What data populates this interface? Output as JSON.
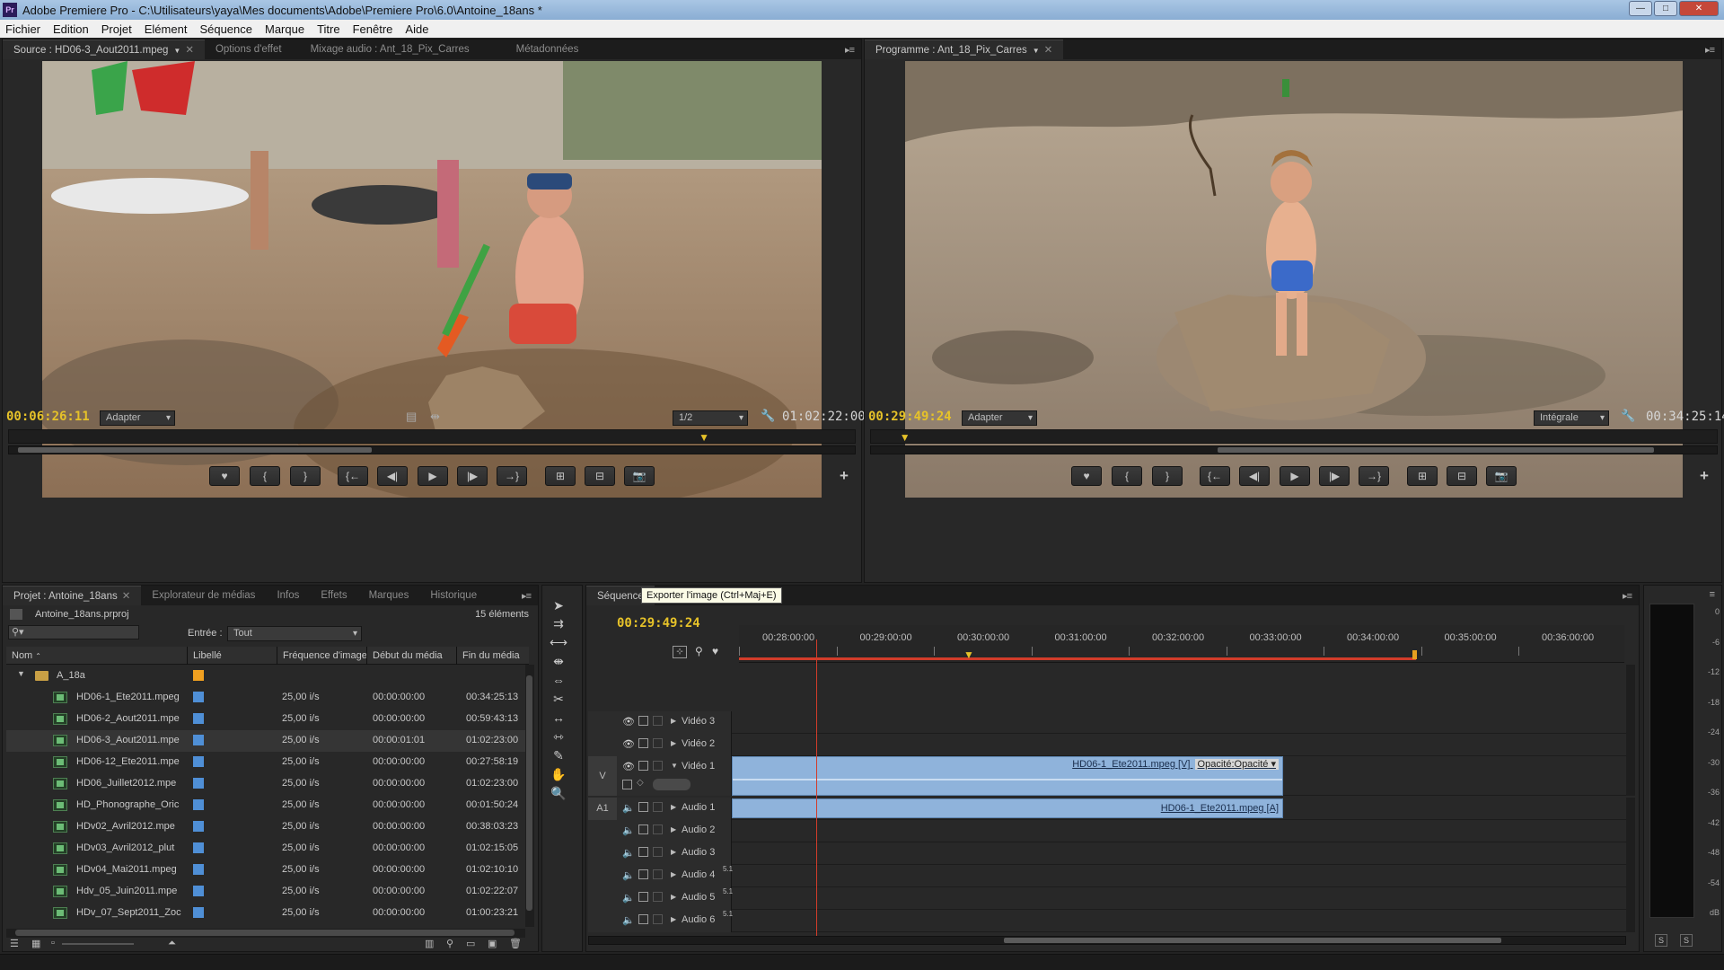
{
  "window": {
    "title": "Adobe Premiere Pro - C:\\Utilisateurs\\yaya\\Mes documents\\Adobe\\Premiere Pro\\6.0\\Antoine_18ans *"
  },
  "menu": [
    "Fichier",
    "Edition",
    "Projet",
    "Elément",
    "Séquence",
    "Marque",
    "Titre",
    "Fenêtre",
    "Aide"
  ],
  "source": {
    "tabs": [
      {
        "label": "Source : HD06-3_Aout2011.mpeg",
        "active": true
      },
      {
        "label": "Options d'effet"
      },
      {
        "label": "Mixage audio : Ant_18_Pix_Carres"
      },
      {
        "label": "Métadonnées"
      }
    ],
    "timecode": "00:06:26:11",
    "fit": "Adapter",
    "resolution": "1/2",
    "duration": "01:02:22:00",
    "playhead_fraction": 0.82
  },
  "program": {
    "tab": "Programme : Ant_18_Pix_Carres",
    "timecode": "00:29:49:24",
    "fit": "Adapter",
    "quality": "Intégrale",
    "duration": "00:34:25:14",
    "playhead_fraction": 0.04
  },
  "project": {
    "tabs": [
      "Projet : Antoine_18ans",
      "Explorateur de médias",
      "Infos",
      "Effets",
      "Marques",
      "Historique"
    ],
    "file": "Antoine_18ans.prproj",
    "count": "15 éléments",
    "entry_label": "Entrée :",
    "entry_value": "Tout",
    "columns": [
      "Nom",
      "Libellé",
      "Fréquence d'image",
      "Début du média",
      "Fin du média"
    ],
    "folder": "A_18a",
    "items": [
      {
        "name": "HD06-1_Ete2011.mpeg",
        "fps": "25,00 i/s",
        "start": "00:00:00:00",
        "end": "00:34:25:13"
      },
      {
        "name": "HD06-2_Aout2011.mpe",
        "fps": "25,00 i/s",
        "start": "00:00:00:00",
        "end": "00:59:43:13"
      },
      {
        "name": "HD06-3_Aout2011.mpe",
        "fps": "25,00 i/s",
        "start": "00:00:01:01",
        "end": "01:02:23:00"
      },
      {
        "name": "HD06-12_Ete2011.mpe",
        "fps": "25,00 i/s",
        "start": "00:00:00:00",
        "end": "00:27:58:19"
      },
      {
        "name": "HD06_Juillet2012.mpe",
        "fps": "25,00 i/s",
        "start": "00:00:00:00",
        "end": "01:02:23:00"
      },
      {
        "name": "HD_Phonographe_Oric",
        "fps": "25,00 i/s",
        "start": "00:00:00:00",
        "end": "00:01:50:24"
      },
      {
        "name": "HDv02_Avril2012.mpe",
        "fps": "25,00 i/s",
        "start": "00:00:00:00",
        "end": "00:38:03:23"
      },
      {
        "name": "HDv03_Avril2012_plut",
        "fps": "25,00 i/s",
        "start": "00:00:00:00",
        "end": "01:02:15:05"
      },
      {
        "name": "HDv04_Mai2011.mpeg",
        "fps": "25,00 i/s",
        "start": "00:00:00:00",
        "end": "01:02:10:10"
      },
      {
        "name": "Hdv_05_Juin2011.mpe",
        "fps": "25,00 i/s",
        "start": "00:00:00:00",
        "end": "01:02:22:07"
      },
      {
        "name": "HDv_07_Sept2011_Zoc",
        "fps": "25,00 i/s",
        "start": "00:00:00:00",
        "end": "01:00:23:21"
      }
    ]
  },
  "timeline": {
    "tab": "Séquence",
    "tooltip": "Exporter l'image (Ctrl+Maj+E)",
    "timecode": "00:29:49:24",
    "ruler": [
      "00:28:00:00",
      "00:29:00:00",
      "00:30:00:00",
      "00:31:00:00",
      "00:32:00:00",
      "00:33:00:00",
      "00:34:00:00",
      "00:35:00:00",
      "00:36:00:00"
    ],
    "video_tracks": [
      "Vidéo 3",
      "Vidéo 2",
      "Vidéo 1"
    ],
    "audio_tracks": [
      "Audio 1",
      "Audio 2",
      "Audio 3",
      "Audio 4",
      "Audio 5",
      "Audio 6"
    ],
    "surround_badge": "5.1",
    "v_target": "V",
    "a_target": "A1",
    "video_clip": "HD06-1_Ete2011.mpeg [V]",
    "opacity": "Opacité:Opacité",
    "audio_clip": "HD06-1_Ete2011.mpeg [A]"
  },
  "meter": {
    "labels": [
      "0",
      "-6",
      "-12",
      "-18",
      "-24",
      "-30",
      "-36",
      "-42",
      "-48",
      "-54",
      "dB"
    ],
    "solo": [
      "S",
      "S"
    ]
  },
  "colors": {
    "timecode": "#e6c229",
    "clip": "#8fb3db",
    "label": "#4f8fd6",
    "folder_label": "#f0a020",
    "playhead": "#d23c2a"
  }
}
